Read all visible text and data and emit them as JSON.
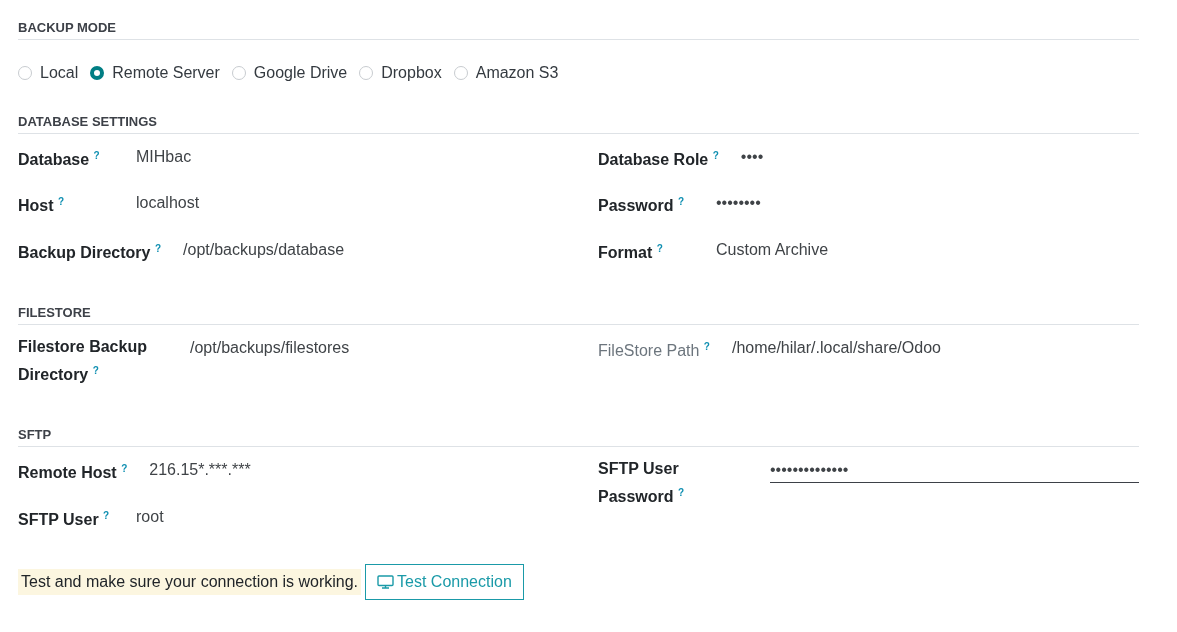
{
  "backup_mode": {
    "title": "BACKUP MODE",
    "options": [
      {
        "label": "Local",
        "selected": false
      },
      {
        "label": "Remote Server",
        "selected": true
      },
      {
        "label": "Google Drive",
        "selected": false
      },
      {
        "label": "Dropbox",
        "selected": false
      },
      {
        "label": "Amazon S3",
        "selected": false
      }
    ]
  },
  "sections": [
    {
      "title": "DATABASE SETTINGS",
      "left": [
        {
          "label": "Database",
          "help": "?",
          "value": "MIHbac",
          "readonly": false,
          "focused": false
        },
        {
          "label": "Host",
          "help": "?",
          "value": "localhost",
          "readonly": false,
          "focused": false
        },
        {
          "label": "Backup Directory",
          "help": "?",
          "value": "/opt/backups/database",
          "readonly": false,
          "focused": false
        }
      ],
      "right": [
        {
          "label": "Database Role",
          "help": "?",
          "value": "••••",
          "readonly": false,
          "focused": false
        },
        {
          "label": "Password",
          "help": "?",
          "value": "••••••••",
          "readonly": false,
          "focused": false
        },
        {
          "label": "Format",
          "help": "?",
          "value": "Custom Archive",
          "readonly": false,
          "focused": false
        }
      ]
    },
    {
      "title": "FILESTORE",
      "left": [
        {
          "label": "Filestore Backup Directory",
          "help": "?",
          "value": "/opt/backups/filestores",
          "readonly": false,
          "focused": false
        }
      ],
      "right": [
        {
          "label": "FileStore Path",
          "help": "?",
          "value": "/home/hilar/.local/share/Odoo",
          "readonly": true,
          "focused": false
        }
      ]
    },
    {
      "title": "SFTP",
      "left": [
        {
          "label": "Remote Host",
          "help": "?",
          "value": "216.15*.***.***",
          "readonly": false,
          "focused": false
        },
        {
          "label": "SFTP User",
          "help": "?",
          "value": "root",
          "readonly": false,
          "focused": false
        }
      ],
      "right": [
        {
          "label": "SFTP User Password",
          "help": "?",
          "value": "••••••••••••••",
          "readonly": false,
          "focused": true
        }
      ]
    }
  ],
  "test": {
    "note": "Test and make sure your connection is working.",
    "button": "Test Connection"
  }
}
